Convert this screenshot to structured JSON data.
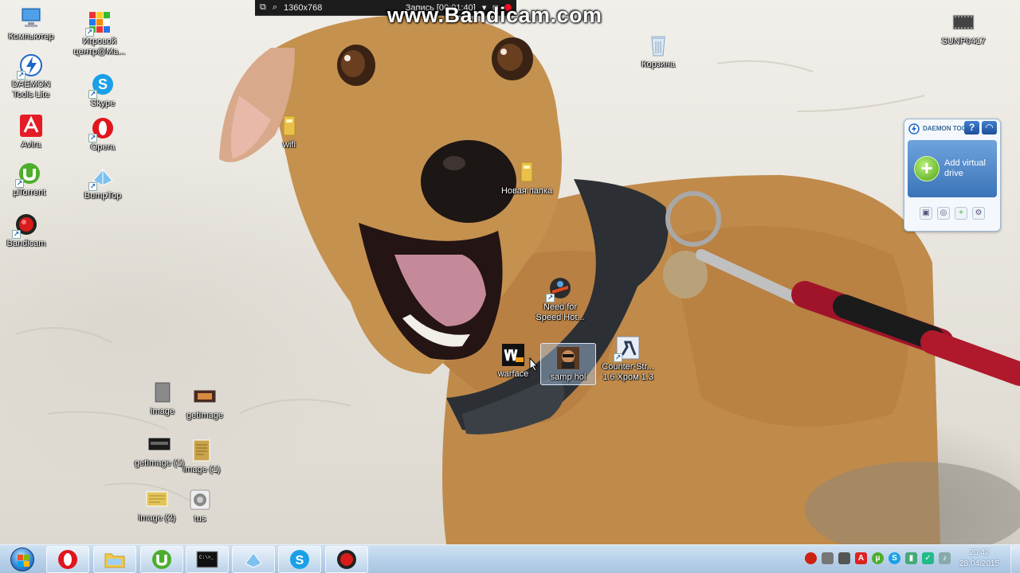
{
  "bandicam": {
    "resolution": "1360x768",
    "record_status": "Запись [00:01:40]",
    "watermark": "www.Bandicam.com"
  },
  "desktop_icons": {
    "computer": "Компьютер",
    "game_center": "Игровой центр@Ma...",
    "daemon_tools": "DAEMON Tools Lite",
    "skype": "Skype",
    "avira": "Avira",
    "opera": "Opera",
    "utorrent": "µTorrent",
    "bumptop": "BumpTop",
    "bandicam": "Bandicam",
    "wifi": "wifi",
    "new_folder": "Новая папка",
    "recycle_bin": "Корзина",
    "sunp": "SUNP0417",
    "nfs": "Need for Speed Hot...",
    "warface": "warface",
    "samp": "samp hol",
    "counter_strike": "Counter-Str... 1.6 Хром 1.3",
    "image": "image",
    "getimage": "getImage",
    "getimage1": "getImage (1)",
    "image1": "image (1)",
    "image2": "image (2)",
    "tus": "tus"
  },
  "daemon_gadget": {
    "brand": "DAEMON TOOLS",
    "help": "?",
    "add_label": "Add virtual drive"
  },
  "taskbar": {
    "pinned": [
      "opera-icon",
      "explorer-icon",
      "utorrent-icon",
      "cmd-icon",
      "bumptop-icon",
      "skype-icon",
      "bandicam-icon"
    ],
    "cmd_text": "C:\\>_"
  },
  "clock": {
    "time": "20:42",
    "date": "28.04.2015"
  },
  "colors": {
    "taskbar": "#b9d2ea",
    "bandicam_rec": "#ee1122",
    "dog_fur": "#c08a4a"
  }
}
